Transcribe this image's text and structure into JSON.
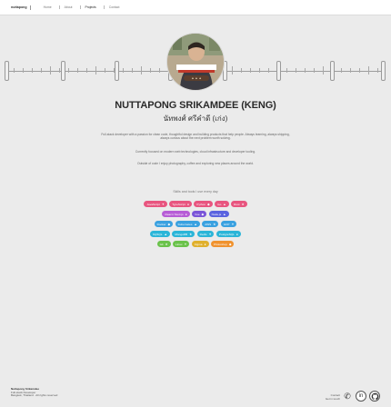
{
  "topbar": {
    "brand": "nuttapong",
    "nav": [
      "Home",
      "About",
      "Projects",
      "Contact"
    ],
    "active_index": 2
  },
  "profile": {
    "name": "NUTTAPONG SRIKAMDEE (KENG)",
    "thai_name": "นัทพงศ์ ศรีคำดี (เก่ง)",
    "bio_1": "Full-stack developer with a passion for clean code, thoughtful design and building products that help people. Always learning, always shipping, always curious about the next problem worth solving.",
    "bio_2": "Currently focused on modern web technologies, cloud infrastructure and developer tooling.",
    "bio_3": "Outside of code I enjoy photography, coffee and exploring new places around the world.",
    "cta": "Skills and tools I use every day"
  },
  "skills": [
    [
      {
        "label": "JavaScript",
        "color": "#e8557f"
      },
      {
        "label": "TypeScript",
        "color": "#e8557f"
      },
      {
        "label": "Python",
        "color": "#e8557f"
      },
      {
        "label": "Go",
        "color": "#e8557f"
      },
      {
        "label": "Rust",
        "color": "#e8557f"
      }
    ],
    [
      {
        "label": "React / Next.js",
        "color": "#b75cd6"
      },
      {
        "label": "Vue",
        "color": "#7b55d8"
      },
      {
        "label": "Node.js",
        "color": "#5b63df"
      }
    ],
    [
      {
        "label": "Docker",
        "color": "#3aa1e0"
      },
      {
        "label": "Kubernetes",
        "color": "#3aa1e0"
      },
      {
        "label": "AWS",
        "color": "#3aa1e0"
      },
      {
        "label": "GCP",
        "color": "#3aa1e0"
      }
    ],
    [
      {
        "label": "MySQL",
        "color": "#2bb5d8"
      },
      {
        "label": "MongoDB",
        "color": "#2bb5d8"
      },
      {
        "label": "Redis",
        "color": "#2bb5d8"
      },
      {
        "label": "PostgreSQL",
        "color": "#2bb5d8"
      }
    ],
    [
      {
        "label": "Git",
        "color": "#6ac24a"
      },
      {
        "label": "Linux",
        "color": "#6ac24a"
      },
      {
        "label": "Figma",
        "color": "#e0b02c"
      },
      {
        "label": "Photoshop",
        "color": "#f0922e"
      }
    ]
  ],
  "footer": {
    "left_title": "Nuttapong Srikamdee",
    "left_line1": "Full-stack Developer",
    "left_line2": "Bangkok, Thailand · All rights reserved",
    "right_line1": "Contact",
    "right_line2": "Get in touch"
  },
  "icons": [
    "phone-icon",
    "linkedin-icon",
    "github-icon"
  ]
}
